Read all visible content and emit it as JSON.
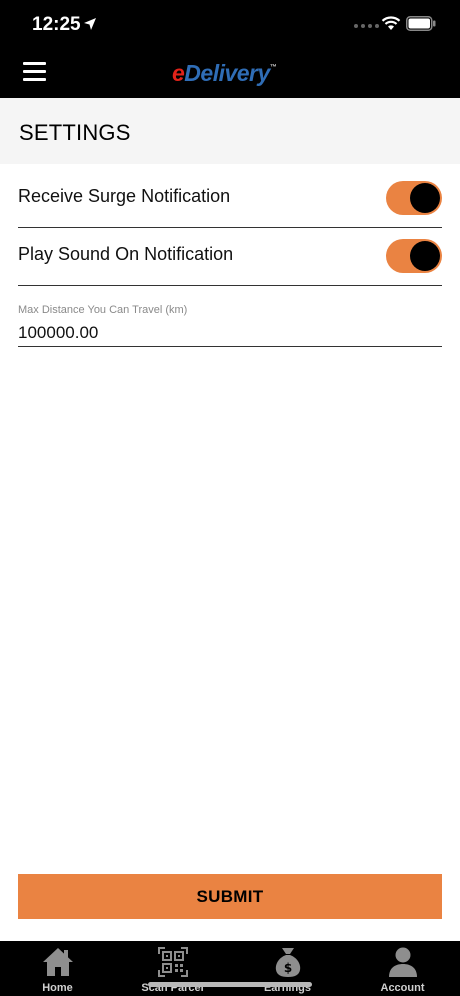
{
  "status_bar": {
    "time": "12:25"
  },
  "header": {
    "brand_e": "e",
    "brand_rest": "Delivery",
    "brand_tm": "™"
  },
  "page": {
    "title": "SETTINGS"
  },
  "settings": {
    "surge_label": "Receive Surge Notification",
    "surge_enabled": true,
    "sound_label": "Play Sound On Notification",
    "sound_enabled": true,
    "distance_label": "Max Distance You Can Travel (km)",
    "distance_value": "100000.00"
  },
  "submit_label": "SUBMIT",
  "tabs": [
    {
      "label": "Home",
      "icon": "home-icon"
    },
    {
      "label": "Scan Parcel",
      "icon": "qr-code-icon"
    },
    {
      "label": "Earnings",
      "icon": "money-bag-icon"
    },
    {
      "label": "Account",
      "icon": "user-icon"
    }
  ],
  "colors": {
    "accent": "#ea8342",
    "bar": "#000000",
    "brand_red": "#e2231a",
    "brand_blue": "#2f6db6"
  }
}
